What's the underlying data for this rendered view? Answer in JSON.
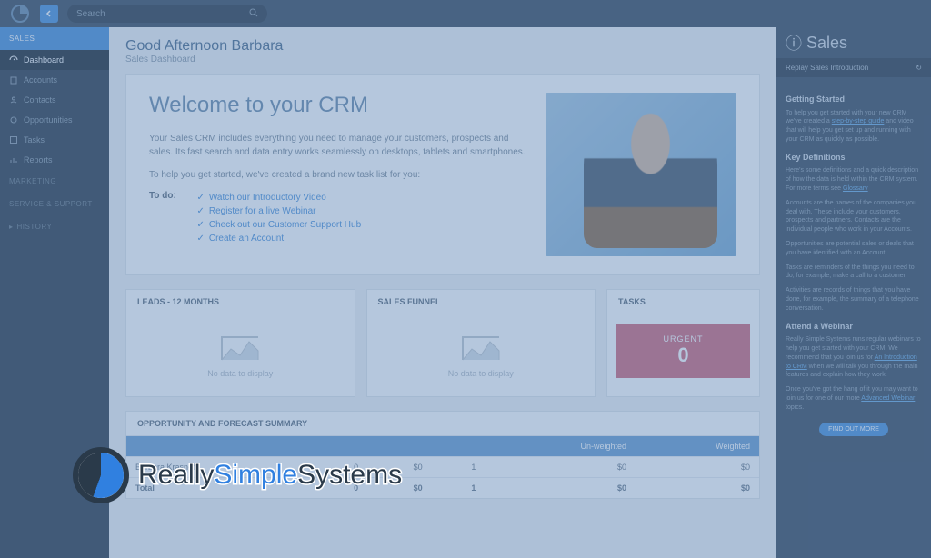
{
  "search": {
    "placeholder": "Search"
  },
  "sidebar": {
    "sections": [
      {
        "label": "SALES",
        "active": true
      },
      {
        "label": "MARKETING"
      },
      {
        "label": "SERVICE & SUPPORT"
      },
      {
        "label": "HISTORY"
      }
    ],
    "items": [
      {
        "label": "Dashboard",
        "icon": "dashboard"
      },
      {
        "label": "Accounts",
        "icon": "building"
      },
      {
        "label": "Contacts",
        "icon": "users"
      },
      {
        "label": "Opportunities",
        "icon": "target"
      },
      {
        "label": "Tasks",
        "icon": "check"
      },
      {
        "label": "Reports",
        "icon": "chart"
      }
    ]
  },
  "greeting": "Good Afternoon Barbara",
  "subtitle": "Sales Dashboard",
  "welcome": {
    "title": "Welcome to your CRM",
    "p1": "Your Sales CRM includes everything you need to manage your customers, prospects and sales. Its fast search and data entry works seamlessly on desktops, tablets and smartphones.",
    "p2": "To help you get started, we've created a brand new task list for you:",
    "todo_label": "To do:",
    "todos": [
      "Watch our Introductory Video",
      "Register for a live Webinar",
      "Check out our Customer Support Hub",
      "Create an Account"
    ]
  },
  "widgets": {
    "leads": {
      "title": "LEADS - 12 MONTHS",
      "msg": "No data to display"
    },
    "funnel": {
      "title": "SALES FUNNEL",
      "msg": "No data to display"
    },
    "tasks": {
      "title": "TASKS",
      "urgent_label": "URGENT",
      "urgent_count": "0"
    }
  },
  "forecast": {
    "title": "OPPORTUNITY AND FORECAST SUMMARY",
    "cols": [
      "",
      "",
      "",
      "",
      "Un-weighted",
      "Weighted"
    ],
    "rows": [
      {
        "cells": [
          "Barbara Krasnoff",
          "0",
          "$0",
          "1",
          "$0",
          "$0"
        ]
      },
      {
        "cells": [
          "Total",
          "0",
          "$0",
          "1",
          "$0",
          "$0"
        ],
        "total": true
      }
    ]
  },
  "rightpanel": {
    "title": "Sales",
    "replay": "Replay Sales Introduction",
    "getting_started_h": "Getting Started",
    "getting_started_p": "To help you get started with your new CRM we've created a ",
    "getting_started_link": "step-by-step guide",
    "getting_started_p2": " and video that will help you get set up and running with your CRM as quickly as possible.",
    "key_def_h": "Key Definitions",
    "key_def_p": "Here's some definitions and a quick description of how the data is held within the CRM system. For more terms see ",
    "key_def_link": "Glossary",
    "accounts_p": "Accounts are the names of the companies you deal with. These include your customers, prospects and partners. Contacts are the individual people who work in your Accounts.",
    "opps_p": "Opportunities are potential sales or deals that you have identified with an Account.",
    "tasks_p": "Tasks are reminders of the things you need to do, for example, make a call to a customer.",
    "activities_p": "Activities are records of things that you have done, for example, the summary of a telephone conversation.",
    "webinar_h": "Attend a Webinar",
    "webinar_p": "Really Simple Systems runs regular webinars to help you get started with your CRM. We recommend that you join us for ",
    "webinar_link": "An Introduction to CRM",
    "webinar_p2": " when we will talk you through the main features and explain how they work.",
    "advanced_p": "Once you've got the hang of it you may want to join us for one of our more ",
    "advanced_link": "Advanced Webinar",
    "advanced_p2": " topics.",
    "btn": "FIND OUT MORE"
  },
  "brand": {
    "really": "Really",
    "simple": "Simple",
    "systems": "Systems"
  }
}
